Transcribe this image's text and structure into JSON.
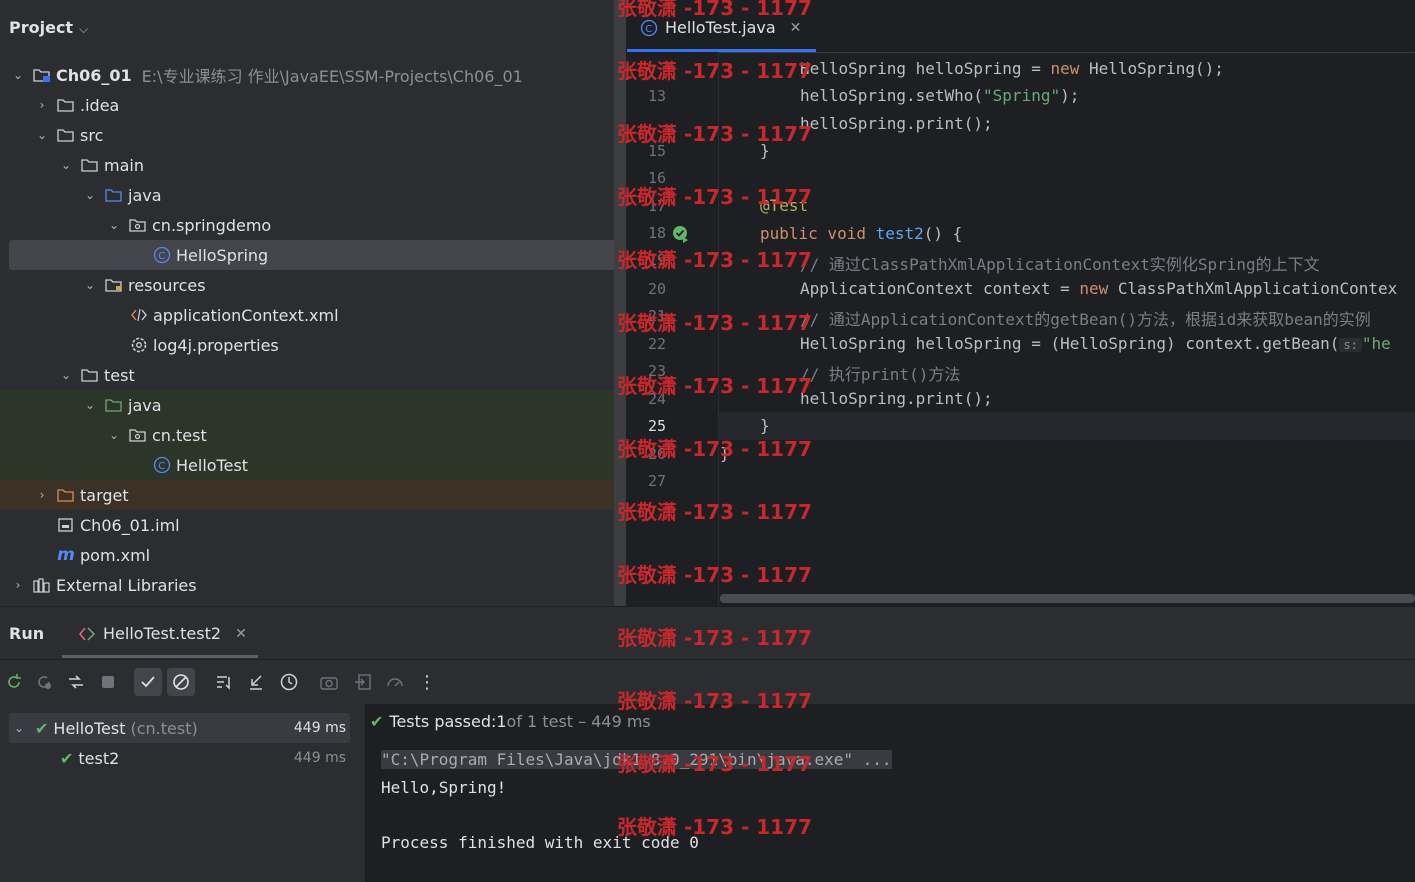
{
  "project": {
    "header": "Project",
    "rows": [
      {
        "label": "Ch06_01",
        "path": "E:\\专业课练习 作业\\JavaEE\\SSM-Projects\\Ch06_01"
      },
      {
        "label": ".idea"
      },
      {
        "label": "src"
      },
      {
        "label": "main"
      },
      {
        "label": "java"
      },
      {
        "label": "cn.springdemo"
      },
      {
        "label": "HelloSpring"
      },
      {
        "label": "resources"
      },
      {
        "label": "applicationContext.xml"
      },
      {
        "label": "log4j.properties"
      },
      {
        "label": "test"
      },
      {
        "label": "java"
      },
      {
        "label": "cn.test"
      },
      {
        "label": "HelloTest"
      },
      {
        "label": "target"
      },
      {
        "label": "Ch06_01.iml"
      },
      {
        "label": "pom.xml"
      },
      {
        "label": "External Libraries"
      }
    ]
  },
  "editor": {
    "tab_label": "HelloTest.java",
    "line_numbers": [
      "13",
      "15",
      "16",
      "17",
      "18",
      "19",
      "20",
      "21",
      "22",
      "23",
      "24",
      "25",
      "26",
      "27"
    ],
    "code": {
      "l12_a": "HelloSpring helloSpring = ",
      "l12_kw": "new",
      "l12_b": " HelloSpring();",
      "l13_a": "helloSpring.setWho(",
      "l13_str": "\"Spring\"",
      "l13_b": ");",
      "l14": "helloSpring.print();",
      "l15": "}",
      "l17": "@Test",
      "l18_kw": "public void ",
      "l18_fn": "test2",
      "l18_b": "() {",
      "l19": "// 通过ClassPathXmlApplicationContext实例化Spring的上下文",
      "l20_a": "ApplicationContext context = ",
      "l20_kw": "new",
      "l20_b": " ClassPathXmlApplicationContex",
      "l21": "// 通过ApplicationContext的getBean()方法，根据id来获取bean的实例",
      "l22_a": "HelloSpring helloSpring = (HelloSpring) context.getBean(",
      "l22_hint": "s:",
      "l22_str": "\"he",
      "l23": "// 执行print()方法",
      "l24": "helloSpring.print();",
      "l25": "}",
      "l26": "}"
    }
  },
  "run": {
    "title": "Run",
    "tab_label": "HelloTest.test2",
    "tests": [
      {
        "name": "HelloTest",
        "pkg": "(cn.test)",
        "time": "449 ms"
      },
      {
        "name": "test2",
        "time": "449 ms"
      }
    ],
    "status": {
      "passed": "Tests passed: ",
      "count": "1",
      "rest": " of 1 test – 449 ms"
    },
    "console": [
      "\"C:\\Program Files\\Java\\jdk1.8.0_291\\bin\\java.exe\" ...",
      "Hello,Spring!",
      "Process finished with exit code 0"
    ]
  },
  "watermark": "张敬潇 -173 - 1177",
  "colors": {
    "accent": "#3574f0",
    "pass": "#5fb865",
    "watermark": "#c8282c"
  }
}
